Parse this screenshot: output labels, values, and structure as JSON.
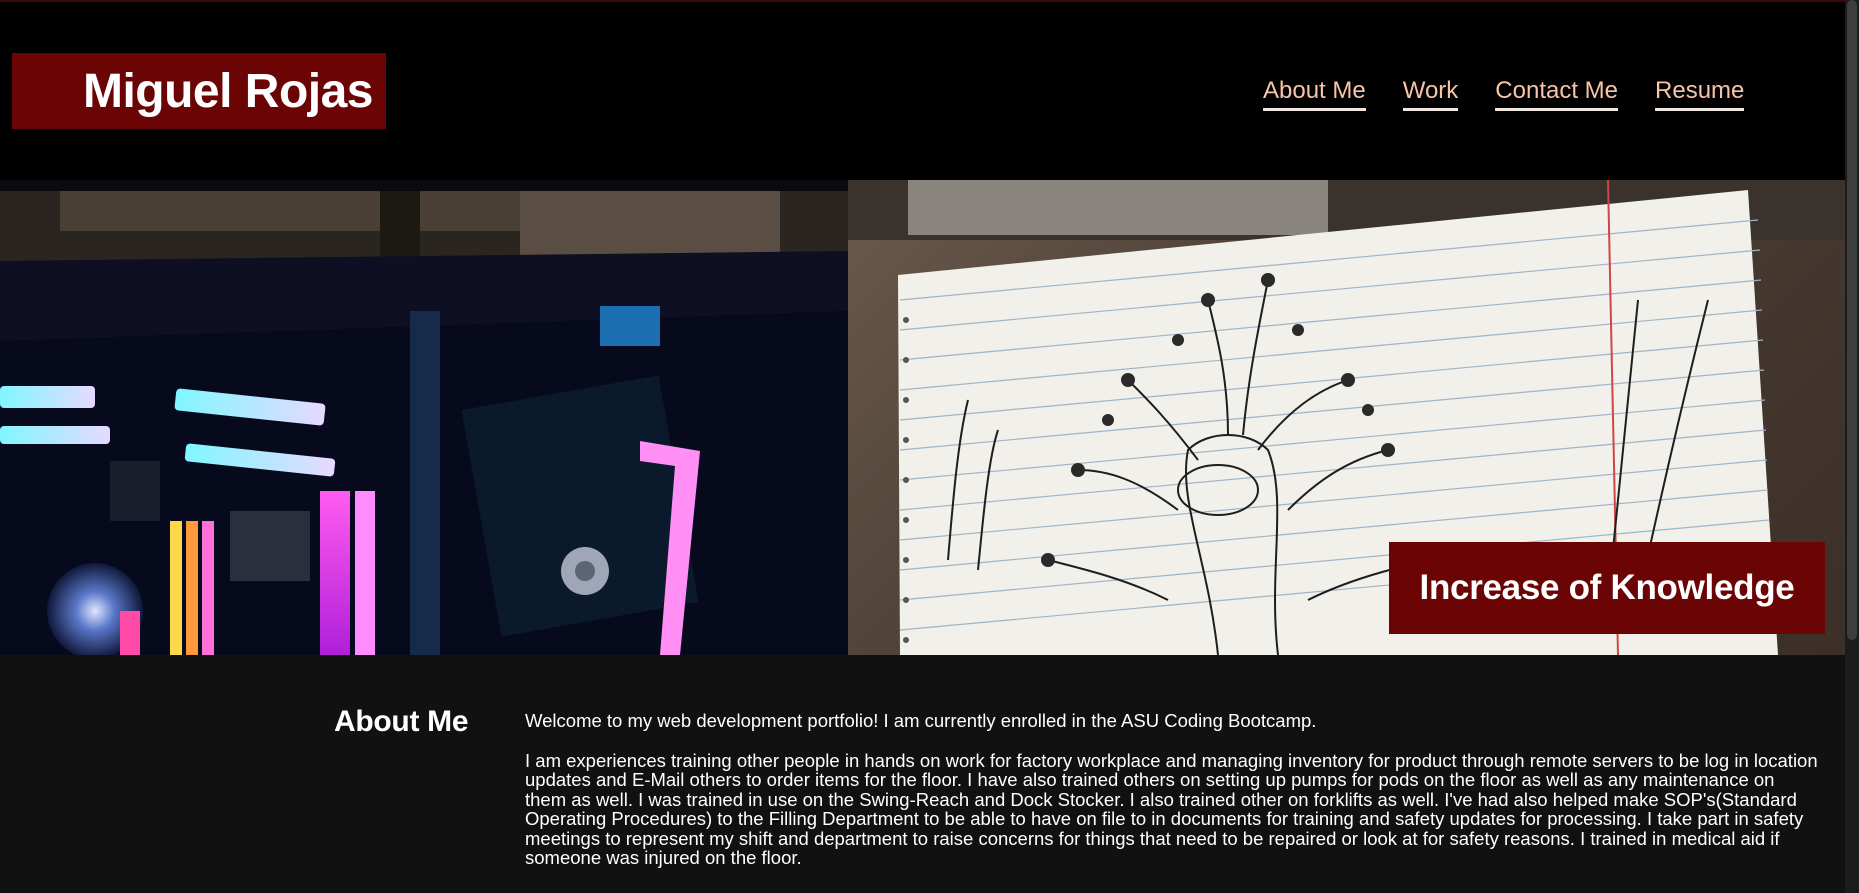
{
  "header": {
    "brand": "Miguel Rojas",
    "nav": [
      "About Me",
      "Work",
      "Contact Me",
      "Resume"
    ]
  },
  "hero": {
    "left_image": "rgb-pc-build-photo",
    "right_image": "notebook-tree-sketch-photo",
    "caption": "Increase of Knowledge"
  },
  "about": {
    "heading": "About Me",
    "paragraphs": [
      "Welcome to my web development portfolio! I am currently enrolled in the ASU Coding Bootcamp.",
      "I am experiences training other people in hands on work for factory workplace and managing inventory for product through remote servers to be log in location updates and E-Mail others to order items for the floor. I have also trained others on setting up pumps for pods on the floor as well as any maintenance on them as well. I was trained in use on the Swing-Reach and Dock Stocker. I also trained other on forklifts as well. I've had also helped make SOP's(Standard Operating Procedures) to the Filling Department to be able to have on file to in documents for training and safety updates for processing. I take part in safety meetings to represent my shift and department to raise concerns for things that need to be repaired or look at for safety reasons. I trained in medical aid if someone was injured on the floor."
    ]
  },
  "colors": {
    "accent": "#6b0505",
    "nav_link": "#f7c4a8",
    "header_bg": "#000000",
    "page_bg": "#111111"
  }
}
